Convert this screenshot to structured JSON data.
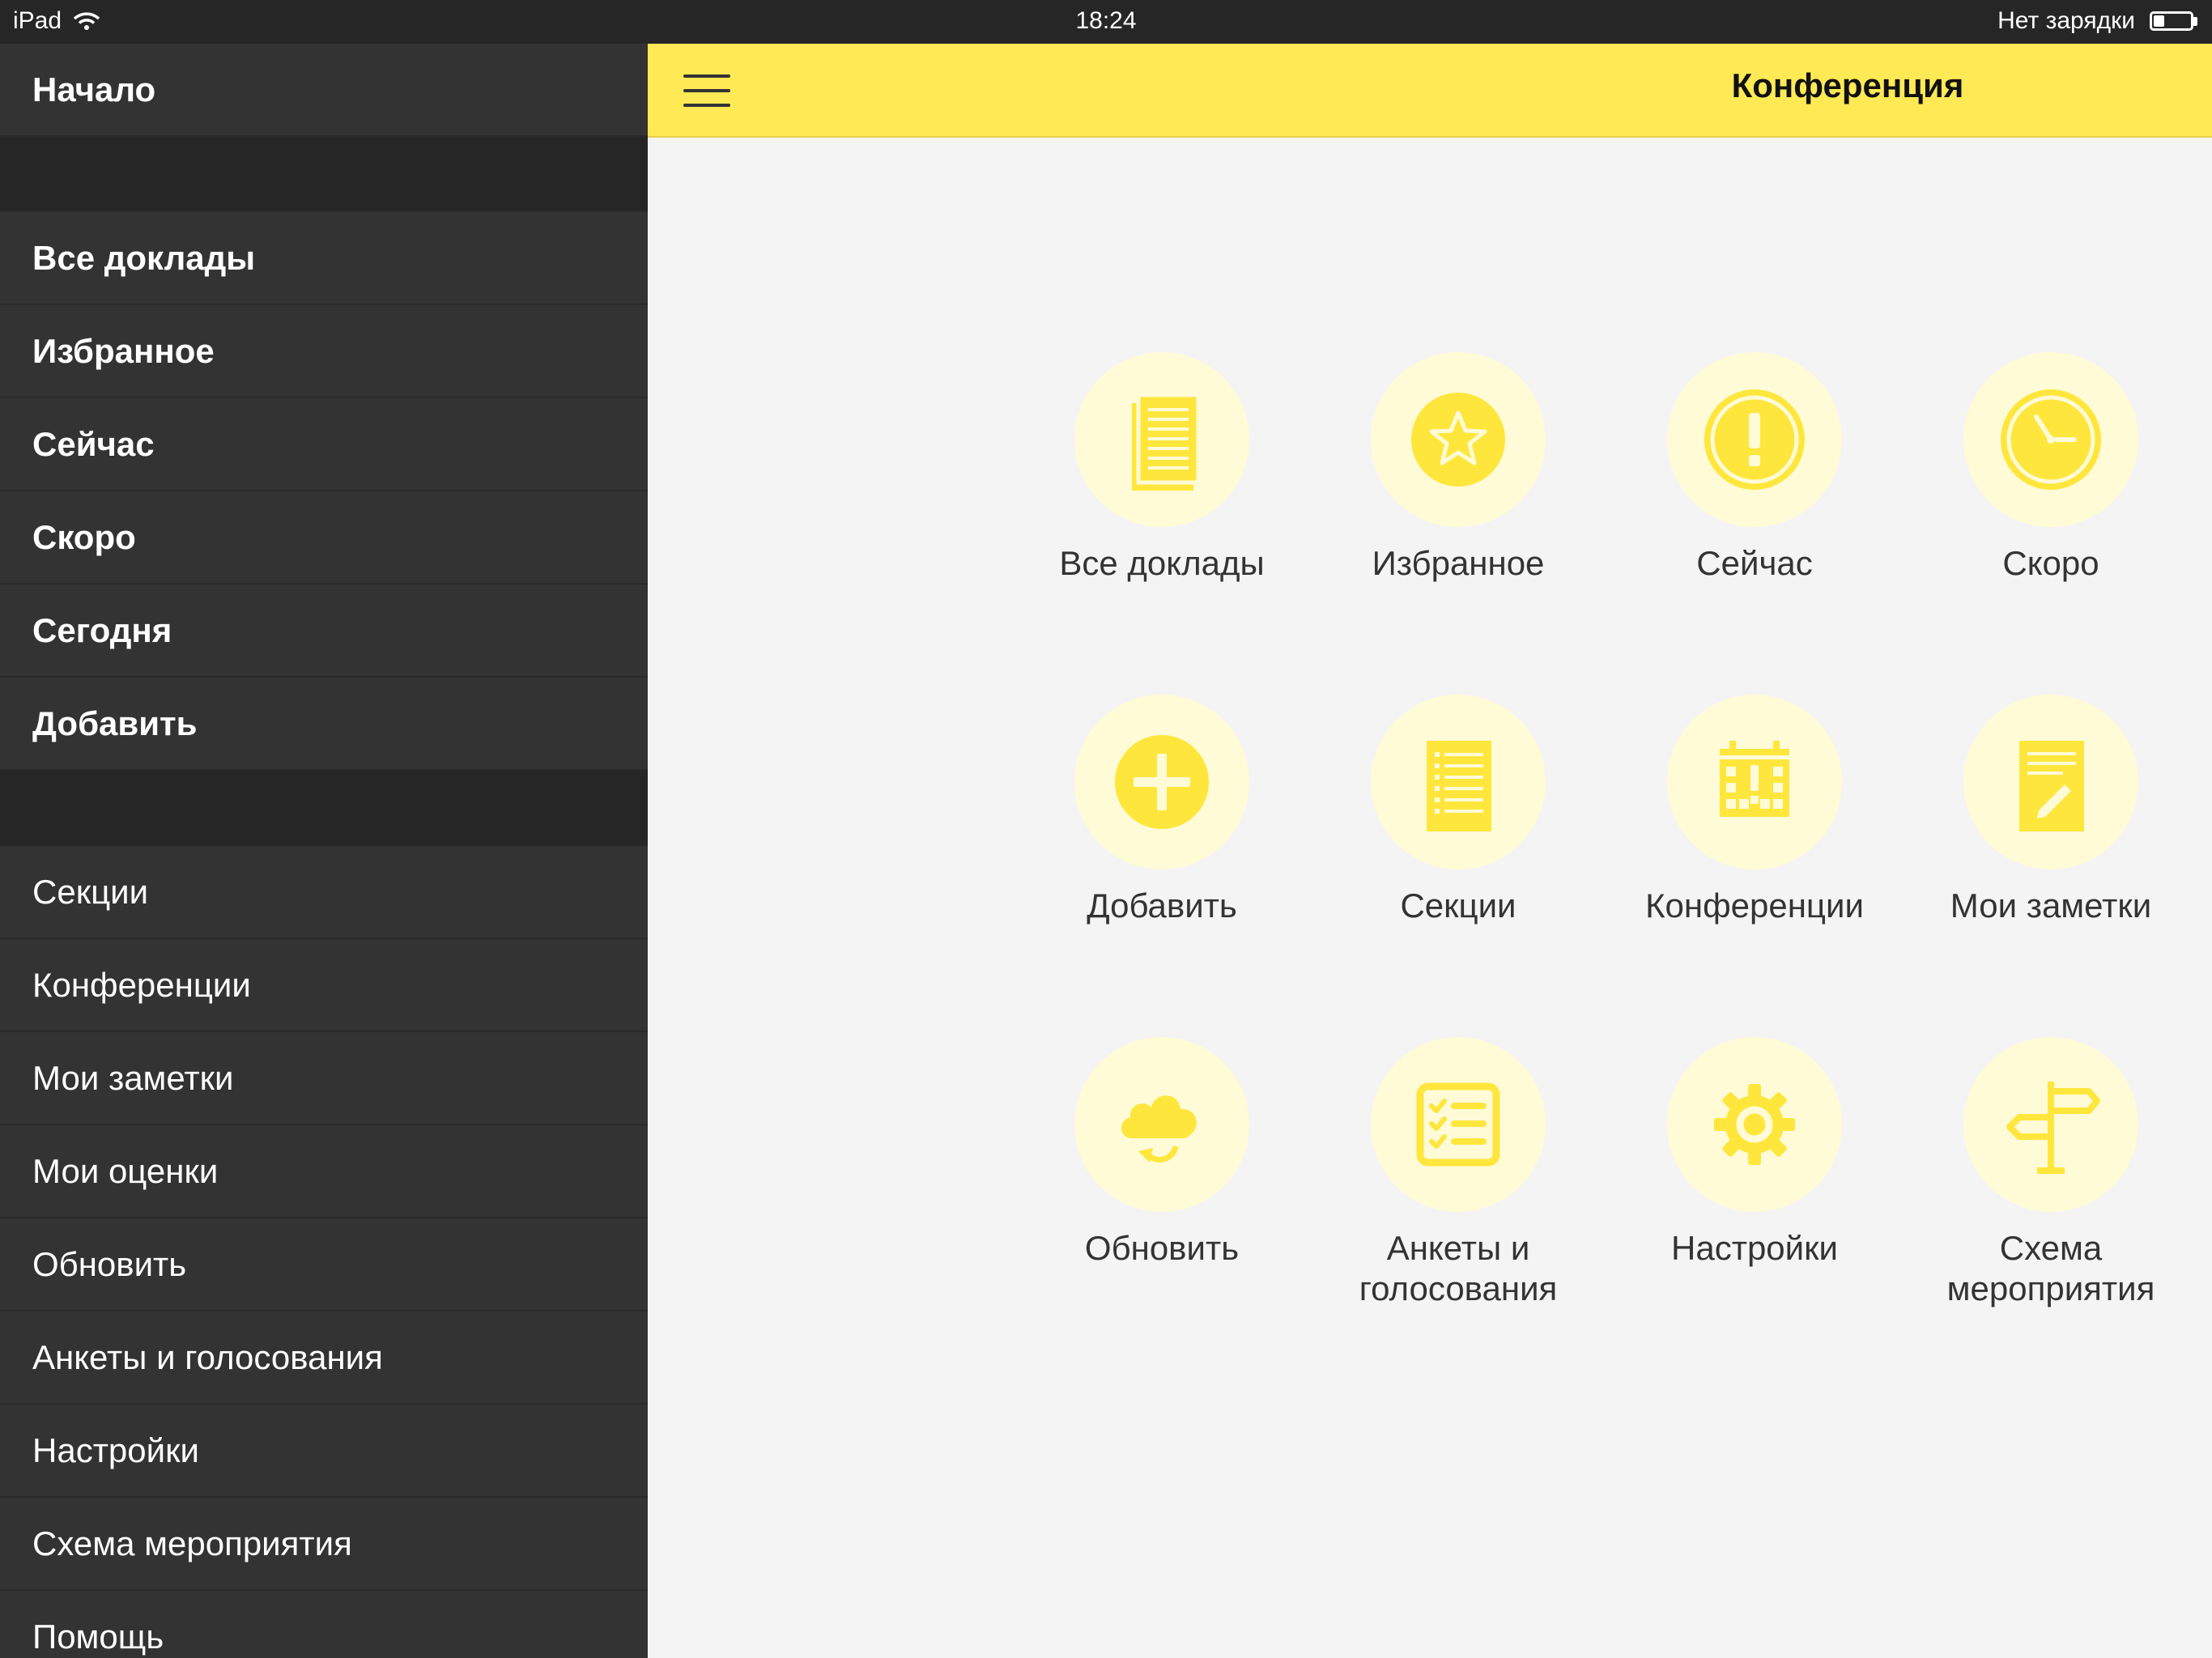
{
  "status_bar": {
    "device": "iPad",
    "time": "18:24",
    "battery_text": "Нет зарядки",
    "battery_level": 0.3
  },
  "sidebar": {
    "home": "Начало",
    "group1": [
      "Все доклады",
      "Избранное",
      "Сейчас",
      "Скоро",
      "Сегодня",
      "Добавить"
    ],
    "group2": [
      "Секции",
      "Конференции",
      "Мои заметки",
      "Мои оценки",
      "Обновить",
      "Анкеты и голосования",
      "Настройки",
      "Схема мероприятия",
      "Помощь"
    ]
  },
  "header": {
    "title": "Конференция"
  },
  "tiles": [
    {
      "label": "Все доклады",
      "icon": "document-list-icon"
    },
    {
      "label": "Избранное",
      "icon": "star-icon"
    },
    {
      "label": "Сейчас",
      "icon": "exclamation-icon"
    },
    {
      "label": "Скоро",
      "icon": "clock-icon"
    },
    {
      "label": "Добавить",
      "icon": "plus-icon"
    },
    {
      "label": "Секции",
      "icon": "section-list-icon"
    },
    {
      "label": "Конференции",
      "icon": "calendar-icon"
    },
    {
      "label": "Мои заметки",
      "icon": "note-pencil-icon"
    },
    {
      "label": "Обновить",
      "icon": "cloud-sync-icon"
    },
    {
      "label": "Анкеты и голосования",
      "icon": "checklist-icon"
    },
    {
      "label": "Настройки",
      "icon": "gear-icon"
    },
    {
      "label": "Схема мероприятия",
      "icon": "signpost-icon"
    }
  ],
  "colors": {
    "accent": "#FFE955",
    "icon_fill": "#FFE63C",
    "icon_bg": "#FFFBD6",
    "sidebar_bg": "#333333"
  }
}
